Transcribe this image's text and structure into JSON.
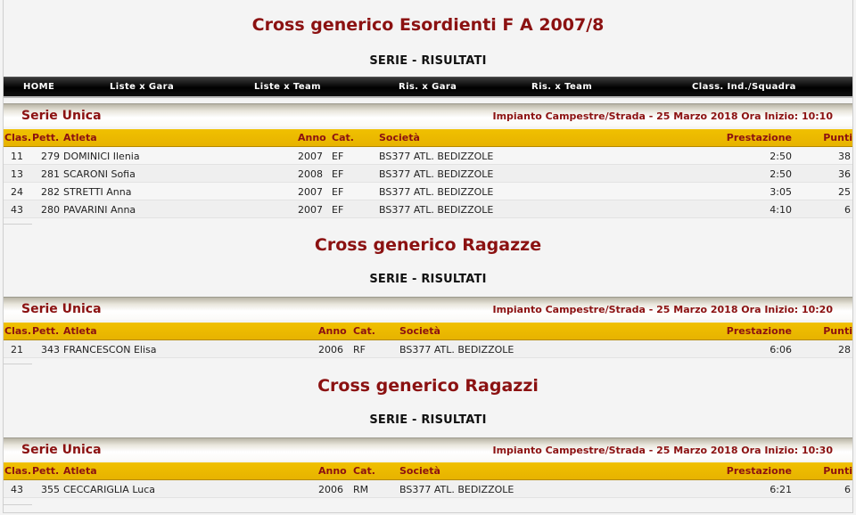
{
  "nav": [
    {
      "label": "HOME"
    },
    {
      "label": "Liste x Gara"
    },
    {
      "label": "Liste x Team"
    },
    {
      "label": "Ris. x Gara"
    },
    {
      "label": "Ris. x Team"
    },
    {
      "label": "Class. Ind./Squadra"
    }
  ],
  "columns": {
    "clas": "Clas.",
    "pett": "Pett.",
    "atleta": "Atleta",
    "anno": "Anno",
    "cat": "Cat.",
    "societa": "Società",
    "prestazione": "Prestazione",
    "punti": "Punti"
  },
  "sections": [
    {
      "title": "Cross generico Esordienti F A 2007/8",
      "subtitle": "SERIE - RISULTATI",
      "serie": "Serie Unica",
      "info": "Impianto Campestre/Strada - 25 Marzo 2018 Ora Inizio: 10:10",
      "rows": [
        {
          "clas": "11",
          "pett": "279",
          "atleta": "DOMINICI Ilenia",
          "anno": "2007",
          "cat": "EF",
          "societa": "BS377 ATL. BEDIZZOLE",
          "prestazione": "2:50",
          "punti": "38"
        },
        {
          "clas": "13",
          "pett": "281",
          "atleta": "SCARONI Sofia",
          "anno": "2008",
          "cat": "EF",
          "societa": "BS377 ATL. BEDIZZOLE",
          "prestazione": "2:50",
          "punti": "36"
        },
        {
          "clas": "24",
          "pett": "282",
          "atleta": "STRETTI Anna",
          "anno": "2007",
          "cat": "EF",
          "societa": "BS377 ATL. BEDIZZOLE",
          "prestazione": "3:05",
          "punti": "25"
        },
        {
          "clas": "43",
          "pett": "280",
          "atleta": "PAVARINI Anna",
          "anno": "2007",
          "cat": "EF",
          "societa": "BS377 ATL. BEDIZZOLE",
          "prestazione": "4:10",
          "punti": "6"
        }
      ]
    },
    {
      "title": "Cross generico Ragazze",
      "subtitle": "SERIE - RISULTATI",
      "serie": "Serie Unica",
      "info": "Impianto Campestre/Strada - 25 Marzo 2018 Ora Inizio: 10:20",
      "rows": [
        {
          "clas": "21",
          "pett": "343",
          "atleta": "FRANCESCON Elisa",
          "anno": "2006",
          "cat": "RF",
          "societa": "BS377 ATL. BEDIZZOLE",
          "prestazione": "6:06",
          "punti": "28"
        }
      ]
    },
    {
      "title": "Cross generico Ragazzi",
      "subtitle": "SERIE - RISULTATI",
      "serie": "Serie Unica",
      "info": "Impianto Campestre/Strada - 25 Marzo 2018 Ora Inizio: 10:30",
      "rows": [
        {
          "clas": "43",
          "pett": "355",
          "atleta": "CECCARIGLIA Luca",
          "anno": "2006",
          "cat": "RM",
          "societa": "BS377 ATL. BEDIZZOLE",
          "prestazione": "6:21",
          "punti": "6"
        }
      ]
    }
  ]
}
